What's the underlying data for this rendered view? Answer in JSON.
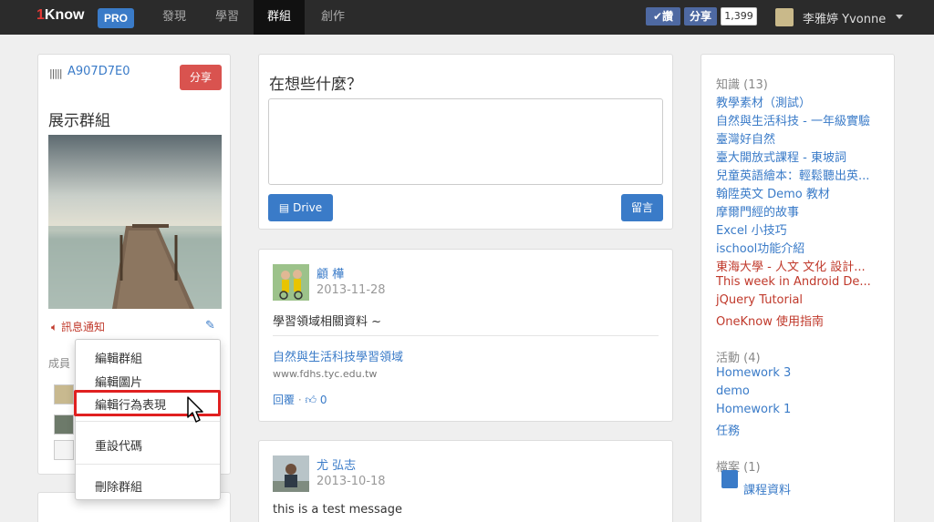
{
  "nav": {
    "logo_num": "1",
    "logo_text": "Know",
    "pro": "PRO",
    "items": [
      "發現",
      "學習",
      "群組",
      "創作"
    ],
    "fb_like": "✔讚",
    "fb_share": "分享",
    "fb_count": "1,399",
    "user": "李雅婷 Yvonne"
  },
  "group": {
    "code": "A907D7E0",
    "share_btn": "分享",
    "title": "展示群組",
    "notify": "訊息通知",
    "members_label": "成員"
  },
  "dropdown": {
    "items": [
      "編輯群組",
      "編輯圖片",
      "編輯行為表現",
      "重設代碼",
      "刪除群組"
    ]
  },
  "composer": {
    "prompt": "在想些什麼？",
    "drive_btn": "Drive",
    "submit_btn": "留言"
  },
  "posts": [
    {
      "author": "顧 樺",
      "date": "2013-11-28",
      "body": "學習領域相關資料 ~",
      "link_title": "自然與生活科技學習領域",
      "link_url": "www.fdhs.tyc.edu.tw",
      "reply": "回覆",
      "likes": "0"
    },
    {
      "author": "尤 弘志",
      "date": "2013-10-18",
      "body": "this is a test message"
    }
  ],
  "sidebar": {
    "knowledge_head": "知識 (13)",
    "knowledge": [
      {
        "label": "教學素材（測試）",
        "color": "blue"
      },
      {
        "label": "自然與生活科技 - 一年級實驗",
        "color": "blue"
      },
      {
        "label": "臺灣好自然",
        "color": "blue"
      },
      {
        "label": "臺大開放式課程 - 東坡詞",
        "color": "blue"
      },
      {
        "label": "兒童英語繪本：輕鬆聽出英...",
        "color": "blue"
      },
      {
        "label": "翰陞英文 Demo 教材",
        "color": "blue"
      },
      {
        "label": "摩爾門經的故事",
        "color": "blue"
      },
      {
        "label": "Excel 小技巧",
        "color": "blue"
      },
      {
        "label": "ischool功能介紹",
        "color": "blue"
      },
      {
        "label": "東海大學 - 人文 文化 設計...",
        "color": "red"
      },
      {
        "label": "This week in Android De...",
        "color": "red"
      },
      {
        "label": "jQuery Tutorial",
        "color": "red"
      },
      {
        "label": "OneKnow 使用指南",
        "color": "red"
      }
    ],
    "activity_head": "活動 (4)",
    "activities": [
      "Homework 3",
      "demo",
      "Homework 1",
      "任務"
    ],
    "files_head": "檔案 (1)",
    "files": [
      "課程資料"
    ]
  },
  "colors": {
    "accent": "#3a7bc8",
    "danger": "#d9534f",
    "topbar": "#2b2b2b"
  }
}
